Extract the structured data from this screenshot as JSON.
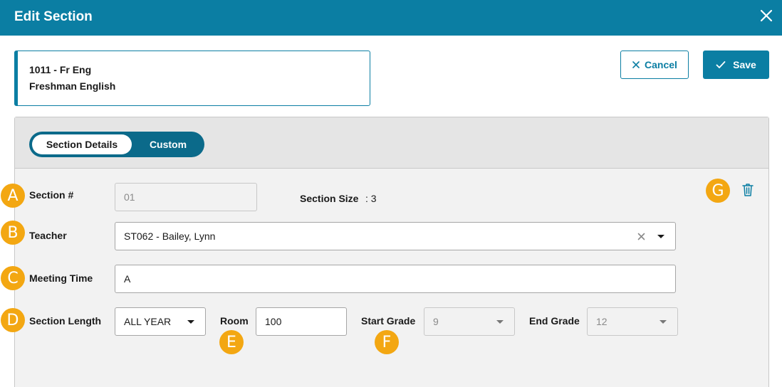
{
  "dialog": {
    "title": "Edit Section"
  },
  "course": {
    "code": "1011 - Fr Eng",
    "name": "Freshman English"
  },
  "actions": {
    "cancel_label": "Cancel",
    "save_label": "Save"
  },
  "tabs": [
    {
      "label": "Section Details",
      "active": true
    },
    {
      "label": "Custom",
      "active": false
    }
  ],
  "form": {
    "section_number": {
      "label": "Section #",
      "value": "01"
    },
    "section_size": {
      "label": "Section Size",
      "value": ": 3"
    },
    "teacher": {
      "label": "Teacher",
      "value": "ST062 - Bailey, Lynn"
    },
    "meeting_time": {
      "label": "Meeting Time",
      "value": "A"
    },
    "section_length": {
      "label": "Section Length",
      "value": "ALL YEAR"
    },
    "room": {
      "label": "Room",
      "value": "100"
    },
    "start_grade": {
      "label": "Start Grade",
      "value": "9"
    },
    "end_grade": {
      "label": "End Grade",
      "value": "12"
    }
  },
  "callouts": [
    "A",
    "B",
    "C",
    "D",
    "E",
    "F",
    "G"
  ],
  "colors": {
    "primary": "#0b7ea3",
    "callout": "#f3a712",
    "panel_bg": "#f2f2f2"
  },
  "icons": {
    "close": "close-icon",
    "cancel": "x-icon",
    "save": "check-icon",
    "delete": "trash-icon",
    "dropdown": "caret-down-icon",
    "clear": "clear-icon"
  }
}
